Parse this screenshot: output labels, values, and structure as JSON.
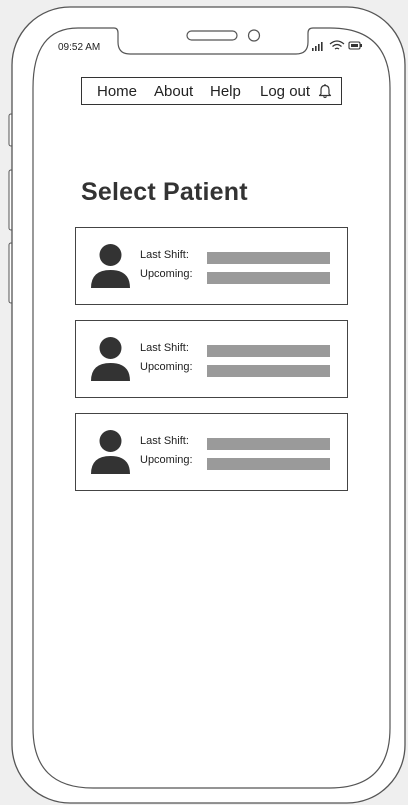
{
  "status": {
    "time": "09:52 AM"
  },
  "nav": {
    "items": [
      {
        "label": "Home"
      },
      {
        "label": "About"
      },
      {
        "label": "Help"
      },
      {
        "label": "Log out"
      }
    ]
  },
  "page": {
    "title": "Select Patient"
  },
  "patients": [
    {
      "last_shift_label": "Last Shift:",
      "upcoming_label": "Upcoming:"
    },
    {
      "last_shift_label": "Last Shift:",
      "upcoming_label": "Upcoming:"
    },
    {
      "last_shift_label": "Last Shift:",
      "upcoming_label": "Upcoming:"
    }
  ],
  "icons": {
    "notification": "bell-icon",
    "avatar": "person-icon",
    "signal": "signal-icon",
    "wifi": "wifi-icon",
    "battery": "battery-icon"
  }
}
